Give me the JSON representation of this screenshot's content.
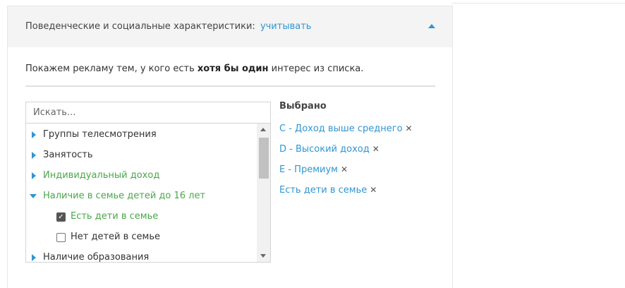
{
  "header": {
    "title": "Поведенческие и социальные характеристики:",
    "link": "учитывать",
    "collapse_icon": "triangle-up"
  },
  "description": {
    "prefix": "Покажем рекламу тем, у кого есть ",
    "bold": "хотя бы один",
    "suffix": " интерес из списка."
  },
  "search": {
    "placeholder": "Искать...",
    "value": ""
  },
  "tree": {
    "items": [
      {
        "label": "Группы телесмотрения",
        "type": "category",
        "expanded": false
      },
      {
        "label": "Занятость",
        "type": "category",
        "expanded": false
      },
      {
        "label": "Индивидуальный доход",
        "type": "category",
        "expanded": false
      },
      {
        "label": "Наличие в семье детей до 16 лет",
        "type": "category",
        "expanded": true
      },
      {
        "label": "Есть дети в семье",
        "type": "option",
        "checked": true
      },
      {
        "label": "Нет детей в семье",
        "type": "option",
        "checked": false
      },
      {
        "label": "Наличие образования",
        "type": "category",
        "expanded": false
      }
    ]
  },
  "selected": {
    "title": "Выбрано",
    "items": [
      "C - Доход выше среднего",
      "D - Высокий доход",
      "E - Премиум",
      "Есть дети в семье"
    ],
    "remove_glyph": "✕"
  },
  "colors": {
    "accent": "#2f96d2",
    "green": "#4aa74a",
    "header_bg": "#f4f4f4"
  }
}
